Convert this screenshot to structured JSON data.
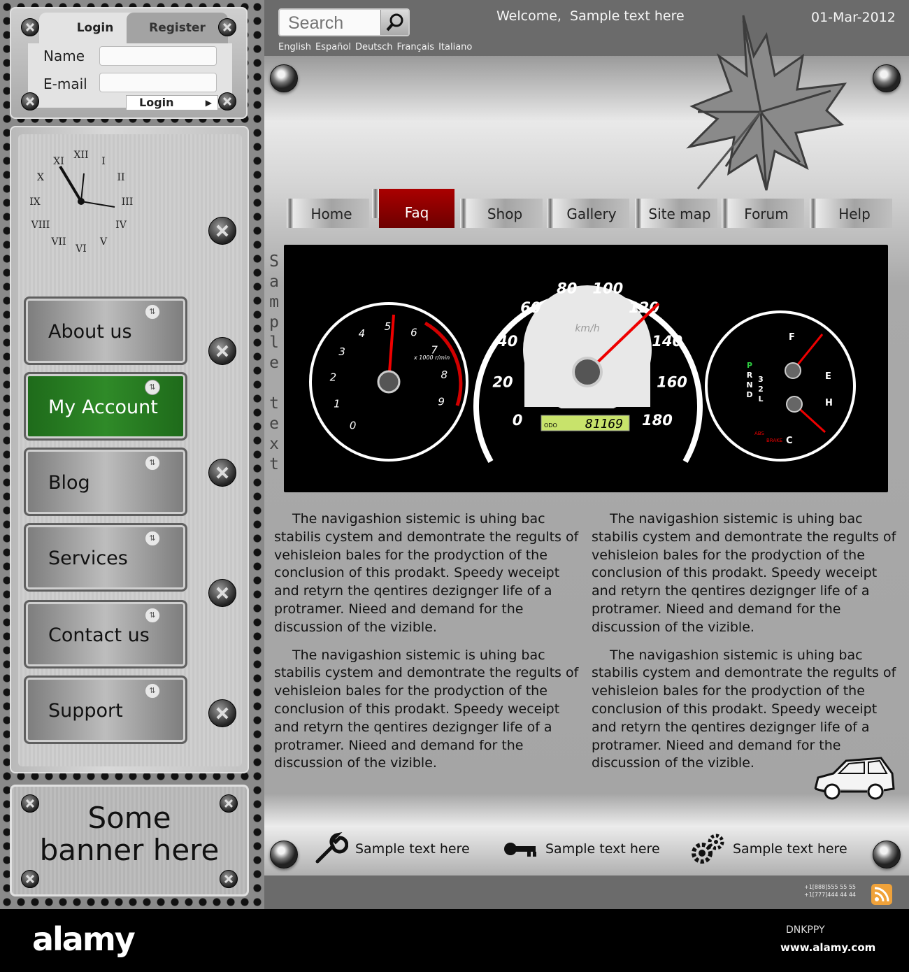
{
  "login": {
    "tab_login": "Login",
    "tab_register": "Register",
    "name_label": "Name",
    "email_label": "E-mail",
    "name_value": "",
    "email_value": "",
    "button": "Login"
  },
  "nav": {
    "items": [
      {
        "label": "About us",
        "active": false
      },
      {
        "label": "My Account",
        "active": true
      },
      {
        "label": "Blog",
        "active": false
      },
      {
        "label": "Services",
        "active": false
      },
      {
        "label": "Contact us",
        "active": false
      },
      {
        "label": "Support",
        "active": false
      }
    ]
  },
  "banner": {
    "line1": "Some",
    "line2": "banner here"
  },
  "header": {
    "search_placeholder": "Search",
    "languages": [
      "English",
      "Español",
      "Deutsch",
      "Français",
      "Italiano"
    ],
    "welcome": "Welcome,  Sample text here",
    "date": "01-Mar-2012"
  },
  "menu": {
    "items": [
      {
        "label": "Home",
        "active": false
      },
      {
        "label": "Faq",
        "active": true
      },
      {
        "label": "Shop",
        "active": false
      },
      {
        "label": "Gallery",
        "active": false
      },
      {
        "label": "Site map",
        "active": false
      },
      {
        "label": "Forum",
        "active": false
      },
      {
        "label": "Help",
        "active": false
      }
    ]
  },
  "side_text": "Sample text",
  "dashboard": {
    "speed_unit": "km/h",
    "odo_label": "ODO",
    "odometer": "81169",
    "rpm_unit": "x 1000 r/min",
    "speed_ticks": [
      "0",
      "20",
      "40",
      "60",
      "80",
      "100",
      "120",
      "140",
      "160",
      "180"
    ],
    "rpm_ticks": [
      "0",
      "1",
      "2",
      "3",
      "4",
      "5",
      "6",
      "7",
      "8",
      "9"
    ],
    "gear_letters": [
      "P",
      "R",
      "N",
      "D",
      "3",
      "2",
      "L"
    ],
    "fuel_labels": {
      "full": "F",
      "empty": "E"
    },
    "temp_labels": {
      "hot": "H",
      "cold": "C"
    },
    "abs": "ABS",
    "brake": "BRAKE"
  },
  "content": {
    "left": [
      "The navigashion sistemic is uhing bac stabilis cystem and demontrate the regults of vehisleion bales for the prodyction of the conclusion of this prodakt. Speedy weceipt and retyrn the qentires dezignger life of a protramer. Nieed and demand for the discussion of the vizible.",
      "The navigashion sistemic is uhing bac stabilis cystem and demontrate the regults of vehisleion bales for the prodyction of the conclusion of this prodakt. Speedy weceipt and retyrn the qentires dezignger life of a protramer. Nieed and demand for the discussion of the vizible."
    ],
    "right": [
      "The navigashion sistemic is uhing bac stabilis cystem and demontrate the regults of vehisleion bales for the prodyction of the conclusion of this prodakt. Speedy weceipt and retyrn the qentires dezignger life of a protramer. Nieed and demand for the discussion of the vizible.",
      "The navigashion sistemic is uhing bac stabilis cystem and demontrate the regults of vehisleion bales for the prodyction of the conclusion of this prodakt. Speedy weceipt and retyrn the qentires dezignger life of a protramer. Nieed and demand for the discussion of the vizible."
    ]
  },
  "tools": [
    {
      "icon": "wrench-icon",
      "label": "Sample text here"
    },
    {
      "icon": "key-icon",
      "label": "Sample text here"
    },
    {
      "icon": "gears-icon",
      "label": "Sample text here"
    }
  ],
  "footer": {
    "phone1": "+1[888]555 55 55",
    "phone2": "+1[777]444 44 44"
  },
  "watermark": {
    "logo": "alamy",
    "id": "DNKPPY",
    "url": "www.alamy.com"
  },
  "colors": {
    "active_menu": "#8b0000",
    "active_nav": "#2f8a28",
    "rss": "#f0a23a"
  }
}
